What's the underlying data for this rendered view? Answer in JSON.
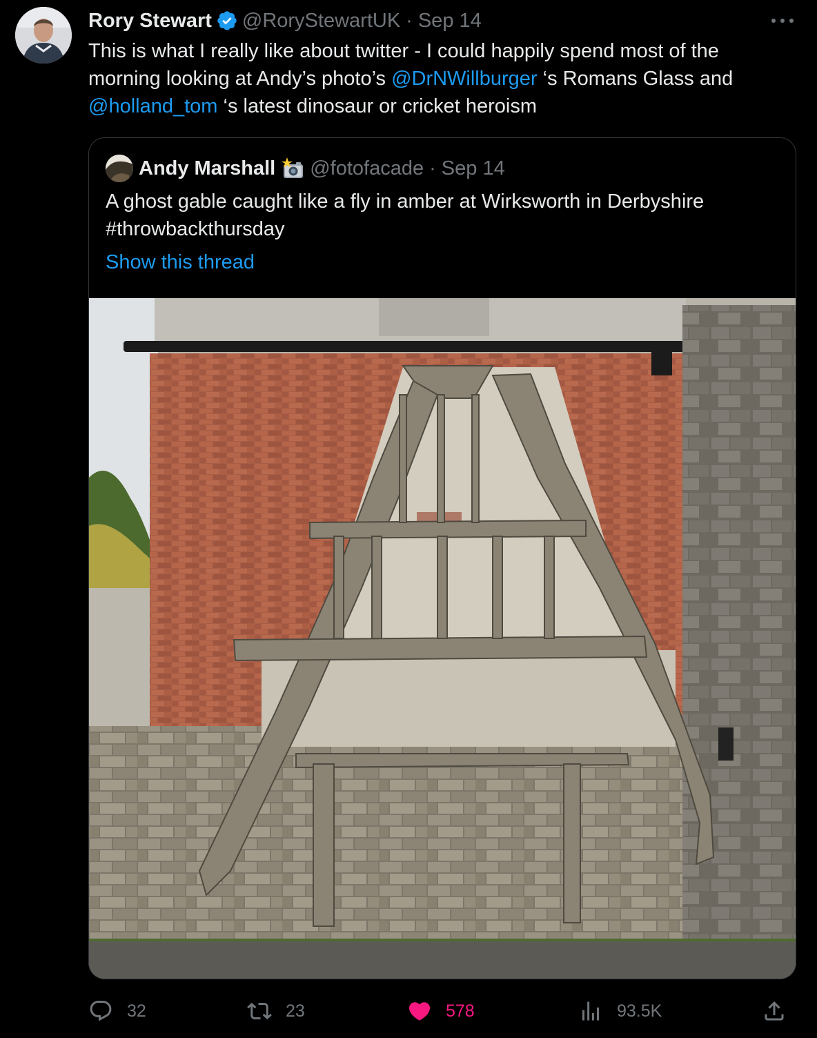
{
  "tweet": {
    "author_name": "Rory Stewart",
    "handle": "@RoryStewartUK",
    "separator": "·",
    "time": "Sep 14",
    "text_parts": [
      "This is what I really like about twitter - I could happily spend most of the morning looking at Andy’s photo’s ",
      "@DrNWillburger",
      " ‘s Romans Glass and ",
      "@holland_tom",
      " ‘s latest dinosaur or cricket heroism"
    ],
    "colors": {
      "accent": "#1d9bf0",
      "verified": "#1d9bf0",
      "like": "#f91880",
      "muted": "#71767b",
      "background": "#000000"
    }
  },
  "quoted": {
    "author_name": "Andy Marshall",
    "badge_icon": "camera-flash-icon",
    "handle": "@fotofacade",
    "separator": "·",
    "time": "Sep 14",
    "text_line1": "A ghost gable caught like a fly in amber at Wirksworth in Derbyshire",
    "text_line2": "#throwbackthursday",
    "show_thread": "Show this thread",
    "photo_icon": "timber-gable-photo"
  },
  "actions": {
    "replies": "32",
    "retweets": "23",
    "likes": "578",
    "views": "93.5K",
    "reply_icon": "reply-icon",
    "retweet_icon": "retweet-icon",
    "like_icon": "heart-icon",
    "views_icon": "views-icon",
    "share_icon": "share-icon"
  }
}
